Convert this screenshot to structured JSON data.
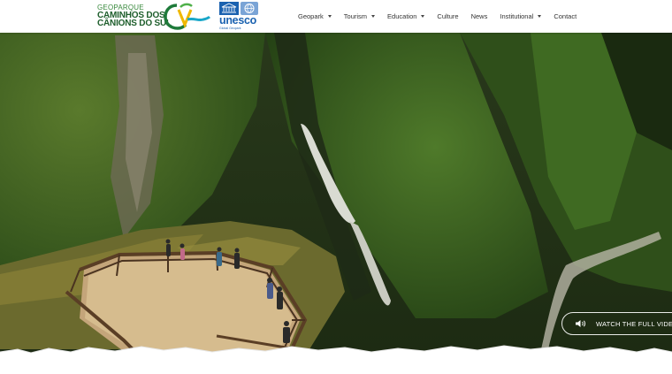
{
  "header": {
    "logo": {
      "line1": "GEOPARQUE",
      "line2": "CAMINHOS DOS",
      "line3": "CÂNIONS DO SUL",
      "icon": "geopark-c-logo-icon"
    },
    "unesco": {
      "word": "unesco",
      "sub": "Global Geopark",
      "icon": "unesco-emblem-icon"
    },
    "nav": [
      {
        "label": "Geopark",
        "has_dropdown": true
      },
      {
        "label": "Tourism",
        "has_dropdown": true
      },
      {
        "label": "Education",
        "has_dropdown": true
      },
      {
        "label": "Culture",
        "has_dropdown": false
      },
      {
        "label": "News",
        "has_dropdown": false
      },
      {
        "label": "Institutional",
        "has_dropdown": true
      },
      {
        "label": "Contact",
        "has_dropdown": false
      }
    ]
  },
  "hero": {
    "watch_button_label": "WATCH THE FULL VIDEO",
    "watch_icon": "speaker-icon"
  },
  "colors": {
    "brand_green": "#1e5e2c",
    "unesco_blue": "#1b62b0",
    "header_bg": "#ffffff"
  }
}
